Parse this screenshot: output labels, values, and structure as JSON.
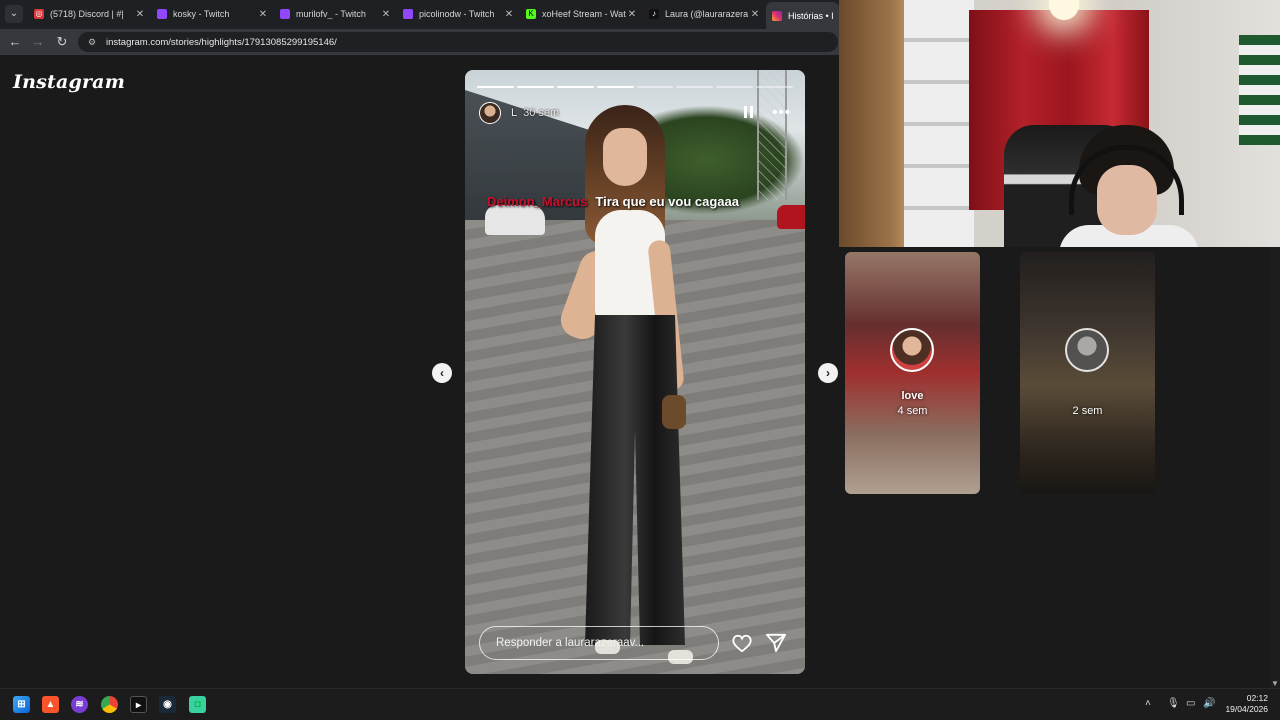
{
  "browser": {
    "tabs": [
      {
        "title": "(5718) Discord | #|",
        "favicon": "discord-icon",
        "color": "#5865f2"
      },
      {
        "title": "kosky - Twitch",
        "favicon": "twitch-icon",
        "color": "#9146ff"
      },
      {
        "title": "murilofv_ - Twitch",
        "favicon": "twitch-icon",
        "color": "#9146ff"
      },
      {
        "title": "picolinodw - Twitch",
        "favicon": "twitch-icon",
        "color": "#9146ff"
      },
      {
        "title": "xoHeef Stream - Wat",
        "favicon": "kick-icon",
        "color": "#53fc18"
      },
      {
        "title": "Laura (@laurarazera",
        "favicon": "tiktok-icon",
        "color": "#111111"
      },
      {
        "title": "Histórias • Insta",
        "favicon": "instagram-icon",
        "color": "#e1306c"
      }
    ],
    "url": "instagram.com/stories/highlights/17913085299195146/"
  },
  "instagram": {
    "logo": "Instagram",
    "story": {
      "username": "L",
      "time": "30 sem",
      "progress_total": 8,
      "progress_done": 4,
      "reply_placeholder": "Responder a laurarazeraav..."
    },
    "chat_overlay": {
      "user": "Deimon_Marcus",
      "message": "Tira que eu vou cagaaa"
    },
    "side_cards": [
      {
        "title": "love",
        "time": "4 sem"
      },
      {
        "title": "",
        "time": "2 sem"
      }
    ]
  },
  "taskbar": {
    "apps": [
      "windows-start-icon",
      "brave-icon",
      "spotify-icon",
      "chrome-icon",
      "terminal-icon",
      "steam-icon",
      "discord-icon"
    ],
    "time": "02:12",
    "date": "19/04/2026"
  }
}
